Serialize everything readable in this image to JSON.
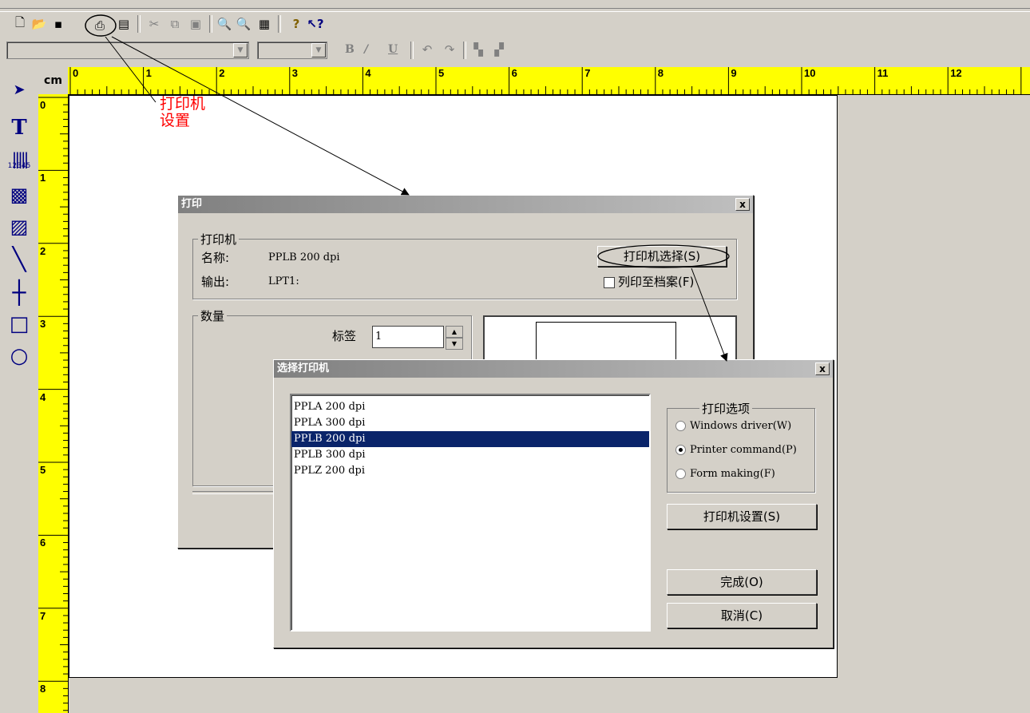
{
  "toolbar": {
    "icons": [
      "new-icon",
      "open-icon",
      "save-icon",
      "print-icon",
      "page-setup-icon",
      "cut-icon",
      "copy-icon",
      "paste-icon",
      "zoom-in-icon",
      "zoom-out-icon",
      "grid-icon",
      "help-icon",
      "context-help-icon"
    ],
    "format_buttons": [
      "B",
      "/",
      "U"
    ]
  },
  "ruler": {
    "unit": "cm",
    "h_numbers": [
      "0",
      "1",
      "2",
      "3",
      "4",
      "5",
      "6",
      "7",
      "8",
      "9",
      "10",
      "11",
      "12"
    ],
    "v_numbers": [
      "0",
      "1",
      "2",
      "3",
      "4",
      "5",
      "6",
      "7",
      "8"
    ]
  },
  "tools": [
    "pointer-tool",
    "text-tool",
    "barcode-tool",
    "2d-barcode-tool",
    "image-tool",
    "line-tool",
    "cross-line-tool",
    "rectangle-tool",
    "ellipse-tool"
  ],
  "annotation": {
    "line1": "打印机",
    "line2": "设置"
  },
  "print_dialog": {
    "title": "打印",
    "close": "x",
    "printer_group": "打印机",
    "name_label": "名称:",
    "name_value": "PPLB 200 dpi",
    "output_label": "输出:",
    "output_value": "LPT1:",
    "select_printer_button": "打印机选择(S)",
    "print_to_file_label": "列印至档案(F)",
    "quantity_group": "数量",
    "labels_label": "标签",
    "labels_value": "1"
  },
  "select_dialog": {
    "title": "选择打印机",
    "close": "x",
    "printers": [
      "PPLA 200 dpi",
      "PPLA 300 dpi",
      "PPLB 200 dpi",
      "PPLB 300 dpi",
      "PPLZ 200 dpi"
    ],
    "selected_index": 2,
    "options_group": "打印选项",
    "options": [
      {
        "label": "Windows driver(W)",
        "checked": false
      },
      {
        "label": "Printer command(P)",
        "checked": true
      },
      {
        "label": "Form making(F)",
        "checked": false
      }
    ],
    "printer_setup_button": "打印机设置(S)",
    "ok_button": "完成(O)",
    "cancel_button": "取消(C)"
  },
  "colors": {
    "ruler": "#ffff00",
    "annotation": "#ff0000",
    "selection": "#0a246a"
  }
}
